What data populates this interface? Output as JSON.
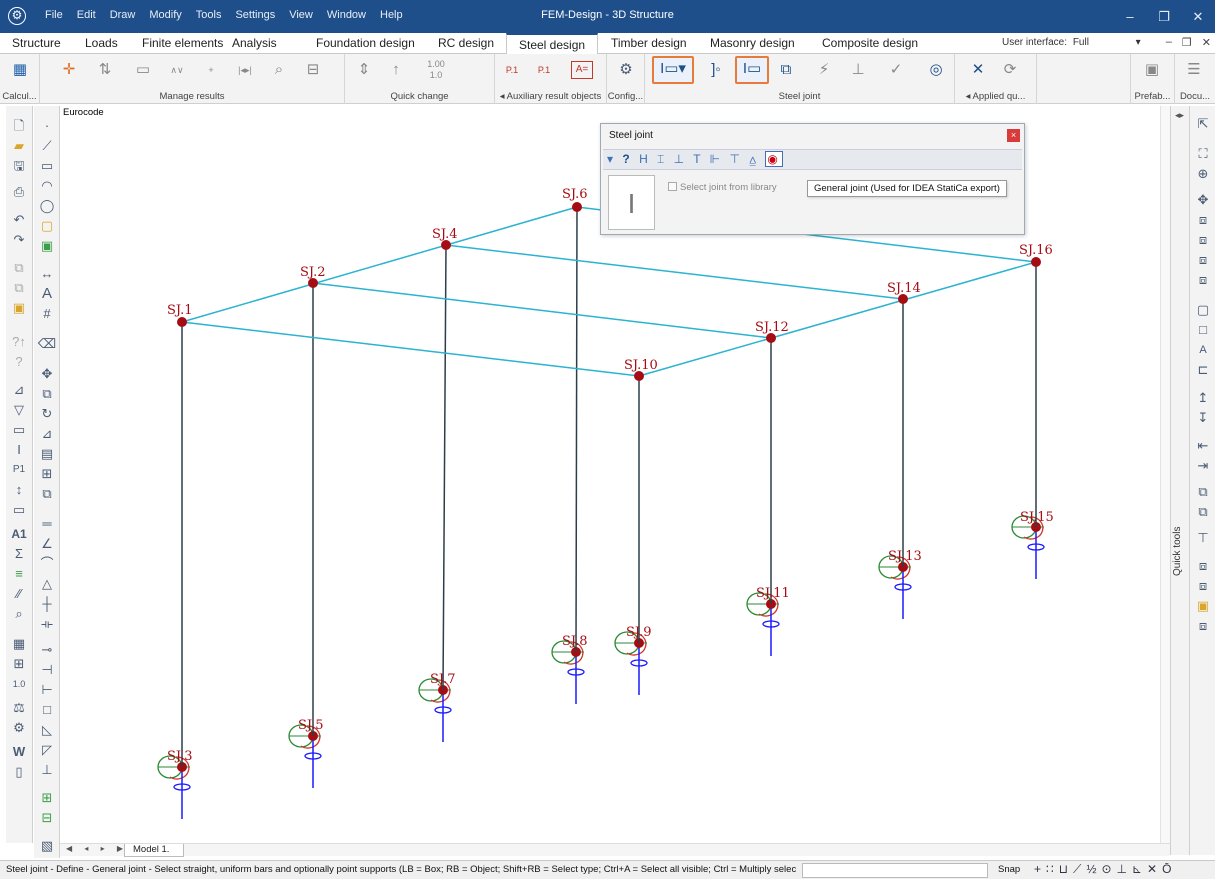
{
  "app": {
    "title": "FEM-Design - 3D Structure",
    "menu": [
      "File",
      "Edit",
      "Draw",
      "Modify",
      "Tools",
      "Settings",
      "View",
      "Window",
      "Help"
    ],
    "window_controls": [
      "–",
      "❐",
      "✕"
    ]
  },
  "ribbon": {
    "tabs": [
      "Structure",
      "Loads",
      "Finite elements",
      "Analysis",
      "Foundation design",
      "RC design",
      "Steel design",
      "Timber design",
      "Masonry design",
      "Composite design"
    ],
    "active_tab": "Steel design",
    "user_interface_label": "User interface:",
    "user_interface_value": "Full",
    "groups": [
      "Calcul...",
      "Manage results",
      "Quick change",
      "◂ Auxiliary result objects",
      "Config...",
      "Steel joint",
      "◂ Applied qu...",
      "Prefab...",
      "Docu..."
    ],
    "quick_change_values": [
      "1.00",
      "1.0"
    ]
  },
  "view": {
    "code_label": "Eurocode",
    "model_tab": "Model 1.",
    "nav": "◀ ◂ ▸ ▶",
    "quick_tools_label": "Quick tools"
  },
  "joints": {
    "top": [
      "SJ.1",
      "SJ.2",
      "SJ.4",
      "SJ.6",
      "SJ.10",
      "SJ.12",
      "SJ.14",
      "SJ.16"
    ],
    "bottom": [
      "SJ.3",
      "SJ.5",
      "SJ.7",
      "SJ.8",
      "SJ.9",
      "SJ.11",
      "SJ.13",
      "SJ.15"
    ]
  },
  "dialog": {
    "title": "Steel joint",
    "close": "×",
    "help": "?",
    "checkbox_label": "Select joint from library",
    "tooltip": "General joint (Used for IDEA StatiCa export)"
  },
  "status": {
    "message": "Steel joint - Define - General joint - Select straight, uniform bars and optionally point supports (LB = Box; RB = Object; Shift+RB = Select type; Ctrl+A = Select all visible; Ctrl = Multiply select...",
    "snap": "Snap"
  },
  "colors": {
    "title_bar": "#1e4f8a",
    "beam": "#2bb3d0",
    "column": "#2c3e4a",
    "joint": "#a50d14",
    "label": "#a50d14",
    "highlight": "#e87b3a"
  }
}
